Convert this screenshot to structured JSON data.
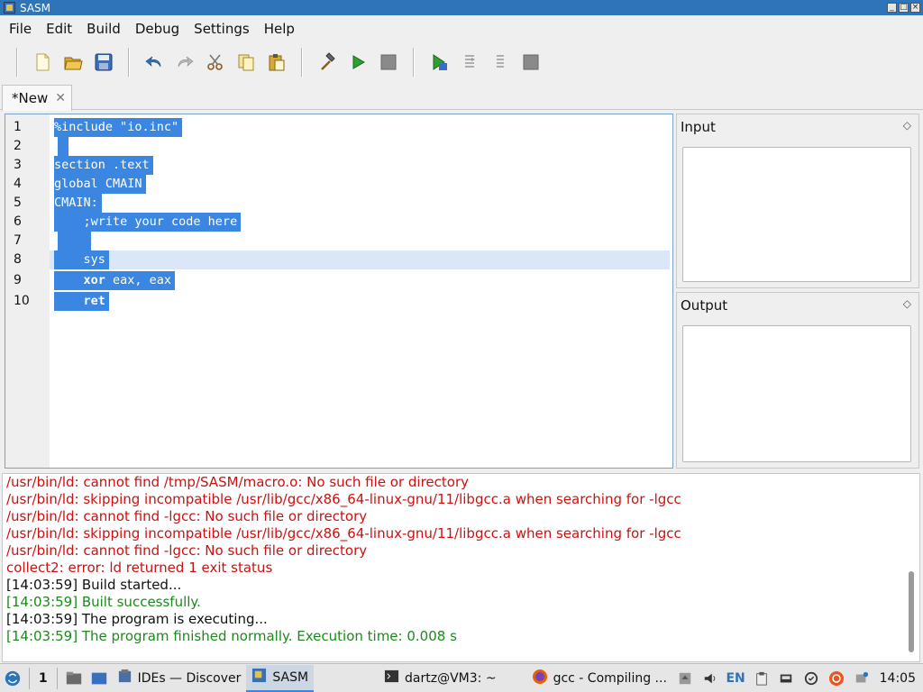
{
  "window": {
    "title": "SASM"
  },
  "menu": [
    "File",
    "Edit",
    "Build",
    "Debug",
    "Settings",
    "Help"
  ],
  "toolbar": {
    "icons": [
      "new-file-icon",
      "open-folder-icon",
      "save-icon",
      "undo-icon",
      "redo-icon",
      "cut-icon",
      "copy-icon",
      "paste-icon",
      "build-hammer-icon",
      "run-icon",
      "stop-icon",
      "debug-icon",
      "step-over-icon",
      "step-into-icon",
      "debug-stop-icon"
    ]
  },
  "tabs": [
    {
      "label": "*New",
      "close": "✕"
    }
  ],
  "editor": {
    "lines": [
      {
        "num": "1",
        "text": "%include \"io.inc\""
      },
      {
        "num": "2",
        "text": " "
      },
      {
        "num": "3",
        "text": "section .text"
      },
      {
        "num": "4",
        "text": "global CMAIN"
      },
      {
        "num": "5",
        "text": "CMAIN:"
      },
      {
        "num": "6",
        "text": "    ;write your code here"
      },
      {
        "num": "7",
        "text": "    "
      },
      {
        "num": "8",
        "text": "    sys"
      },
      {
        "num": "9",
        "kw": "xor",
        "rest": " eax, eax",
        "indent": "    "
      },
      {
        "num": "10",
        "kw": "ret",
        "rest": "",
        "indent": "    "
      }
    ]
  },
  "panels": {
    "input": {
      "title": "Input",
      "dock": "◇"
    },
    "output": {
      "title": "Output",
      "dock": "◇"
    }
  },
  "log": [
    {
      "text": "/usr/bin/ld: cannot find /tmp/SASM/macro.o: No such file or directory",
      "color": "red"
    },
    {
      "text": "/usr/bin/ld: skipping incompatible /usr/lib/gcc/x86_64-linux-gnu/11/libgcc.a when searching for -lgcc",
      "color": "red"
    },
    {
      "text": "/usr/bin/ld: cannot find -lgcc: No such file or directory",
      "color": "red"
    },
    {
      "text": "/usr/bin/ld: skipping incompatible /usr/lib/gcc/x86_64-linux-gnu/11/libgcc.a when searching for -lgcc",
      "color": "red"
    },
    {
      "text": "/usr/bin/ld: cannot find -lgcc: No such file or directory",
      "color": "red"
    },
    {
      "text": "collect2: error: ld returned 1 exit status",
      "color": "red"
    },
    {
      "text": "[14:03:59] Build started...",
      "color": "black"
    },
    {
      "text": "[14:03:59] Built successfully.",
      "color": "green"
    },
    {
      "text": "[14:03:59] The program is executing...",
      "color": "black"
    },
    {
      "text": "[14:03:59] The program finished normally. Execution time: 0.008 s",
      "color": "green"
    }
  ],
  "taskbar": {
    "workspace": "1",
    "tasks": [
      {
        "label": "IDEs — Discover",
        "icon": "discover-icon"
      },
      {
        "label": "SASM",
        "icon": "sasm-icon",
        "active": true
      },
      {
        "label": "dartz@VM3: ~",
        "icon": "terminal-icon"
      },
      {
        "label": "gcc - Compiling ...",
        "icon": "firefox-icon"
      }
    ],
    "lang": "EN",
    "clock": "14:05"
  },
  "colors": {
    "selection": "#3a86e0",
    "titlebar": "#2d74b8",
    "error": "#cc1111",
    "success": "#1b8a1b"
  }
}
